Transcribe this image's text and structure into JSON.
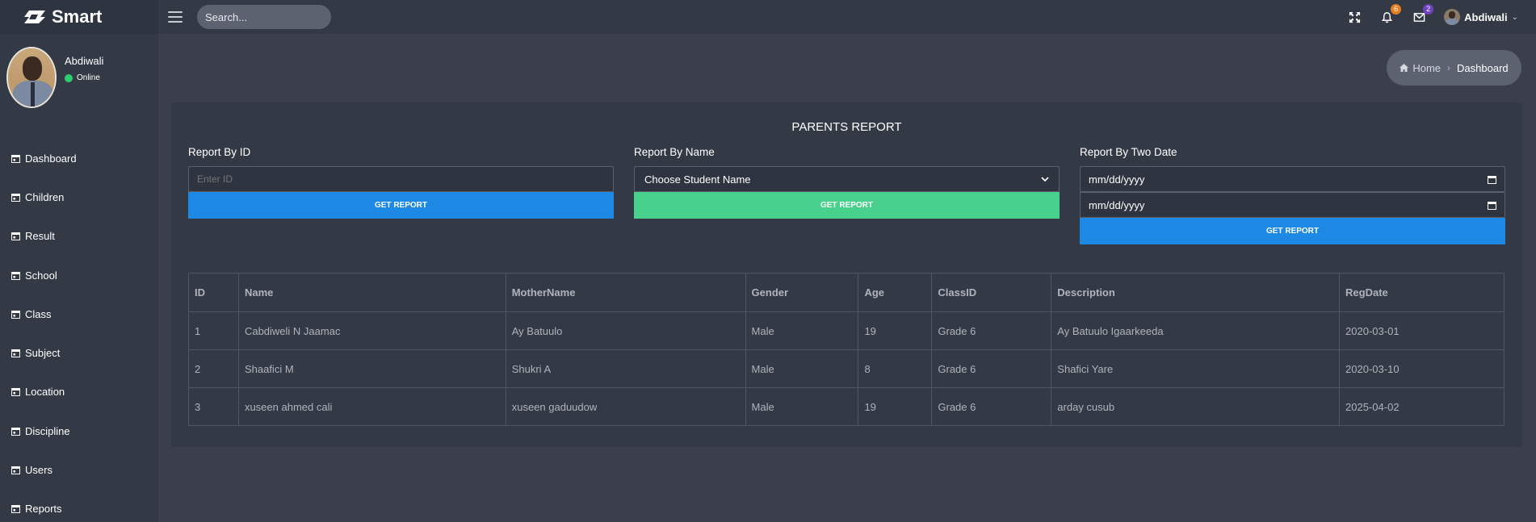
{
  "brand": {
    "name": "Smart"
  },
  "search": {
    "placeholder": "Search..."
  },
  "topbar": {
    "notifications_count": "6",
    "messages_count": "2",
    "user_name": "Abdiwali",
    "badge_colors": {
      "notifications": "#e67e22",
      "messages": "#6f42c1"
    }
  },
  "sidebar": {
    "profile": {
      "name": "Abdiwali",
      "status": "Online"
    },
    "items": [
      {
        "label": "Dashboard"
      },
      {
        "label": "Children"
      },
      {
        "label": "Result"
      },
      {
        "label": "School"
      },
      {
        "label": "Class"
      },
      {
        "label": "Subject"
      },
      {
        "label": "Location"
      },
      {
        "label": "Discipline"
      },
      {
        "label": "Users"
      },
      {
        "label": "Reports"
      }
    ]
  },
  "breadcrumb": {
    "home": "Home",
    "current": "Dashboard"
  },
  "report": {
    "title": "PARENTS REPORT",
    "by_id": {
      "label": "Report By ID",
      "placeholder": "Enter ID",
      "button": "GET REPORT"
    },
    "by_name": {
      "label": "Report By Name",
      "selected": "Choose Student Name",
      "button": "GET REPORT"
    },
    "by_date": {
      "label": "Report By Two Date",
      "date1": "mm/dd/yyyy",
      "date2": "mm/dd/yyyy",
      "button": "GET REPORT"
    }
  },
  "table": {
    "headers": [
      "ID",
      "Name",
      "MotherName",
      "Gender",
      "Age",
      "ClassID",
      "Description",
      "RegDate"
    ],
    "rows": [
      [
        "1",
        "Cabdiweli N Jaamac",
        "Ay Batuulo",
        "Male",
        "19",
        "Grade 6",
        "Ay Batuulo Igaarkeeda",
        "2020-03-01"
      ],
      [
        "2",
        "Shaafici M",
        "Shukri A",
        "Male",
        "8",
        "Grade 6",
        "Shafici Yare",
        "2020-03-10"
      ],
      [
        "3",
        "xuseen ahmed cali",
        "xuseen gaduudow",
        "Male",
        "19",
        "Grade 6",
        "arday cusub",
        "2025-04-02"
      ]
    ]
  }
}
